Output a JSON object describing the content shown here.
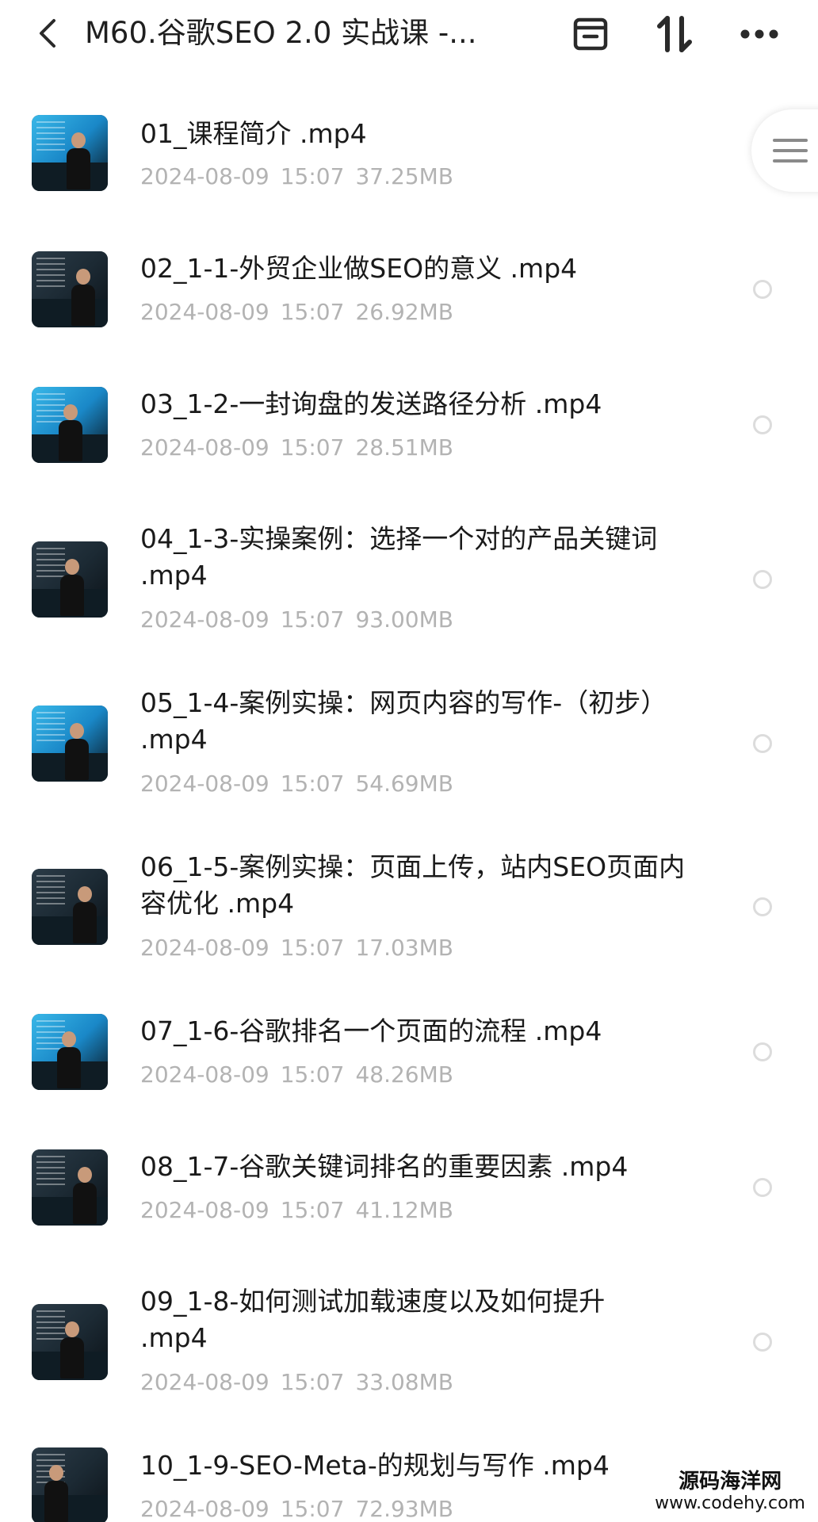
{
  "header": {
    "back_icon": "chevron-left-icon",
    "title": "M60.谷歌SEO 2.0 实战课 -...",
    "archive_icon": "archive-box-icon",
    "sort_icon": "sort-arrows-icon",
    "more_icon": "more-dots-icon"
  },
  "side_tab": {
    "icon": "hamburger-menu-icon"
  },
  "files": [
    {
      "name": "01_课程简介 .mp4",
      "date": "2024-08-09",
      "time": "15:07",
      "size": "37.25MB"
    },
    {
      "name": "02_1-1-外贸企业做SEO的意义 .mp4",
      "date": "2024-08-09",
      "time": "15:07",
      "size": "26.92MB"
    },
    {
      "name": "03_1-2-一封询盘的发送路径分析 .mp4",
      "date": "2024-08-09",
      "time": "15:07",
      "size": "28.51MB"
    },
    {
      "name": "04_1-3-实操案例：选择一个对的产品关键词 .mp4",
      "date": "2024-08-09",
      "time": "15:07",
      "size": "93.00MB"
    },
    {
      "name": "05_1-4-案例实操：网页内容的写作-（初步） .mp4",
      "date": "2024-08-09",
      "time": "15:07",
      "size": "54.69MB"
    },
    {
      "name": "06_1-5-案例实操：页面上传，站内SEO页面内容优化 .mp4",
      "date": "2024-08-09",
      "time": "15:07",
      "size": "17.03MB"
    },
    {
      "name": "07_1-6-谷歌排名一个页面的流程 .mp4",
      "date": "2024-08-09",
      "time": "15:07",
      "size": "48.26MB"
    },
    {
      "name": "08_1-7-谷歌关键词排名的重要因素 .mp4",
      "date": "2024-08-09",
      "time": "15:07",
      "size": "41.12MB"
    },
    {
      "name": "09_1-8-如何测试加载速度以及如何提升 .mp4",
      "date": "2024-08-09",
      "time": "15:07",
      "size": "33.08MB"
    },
    {
      "name": "10_1-9-SEO-Meta-的规划与写作 .mp4",
      "date": "2024-08-09",
      "time": "15:07",
      "size": "72.93MB"
    }
  ],
  "watermark": {
    "line1": "源码海洋网",
    "line2": "www.codehy.com"
  }
}
